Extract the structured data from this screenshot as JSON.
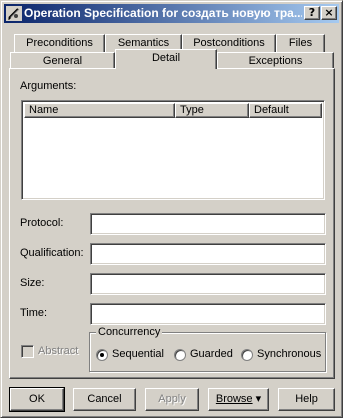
{
  "window": {
    "title": "Operation Specification for создать новую тра...",
    "help_glyph": "?",
    "close_glyph": "×",
    "icon": "pencil-icon"
  },
  "tabs": {
    "row1": [
      {
        "label": "Preconditions"
      },
      {
        "label": "Semantics"
      },
      {
        "label": "Postconditions"
      },
      {
        "label": "Files"
      }
    ],
    "row2": [
      {
        "label": "General"
      },
      {
        "label": "Detail"
      },
      {
        "label": "Exceptions"
      }
    ],
    "active": "Detail"
  },
  "detail": {
    "arguments_label": "Arguments:",
    "columns": [
      "Name",
      "Type",
      "Default"
    ],
    "rows": [],
    "protocol_label": "Protocol:",
    "protocol_value": "",
    "qualification_label": "Qualification:",
    "qualification_value": "",
    "size_label": "Size:",
    "size_value": "",
    "time_label": "Time:",
    "time_value": "",
    "abstract_label": "Abstract",
    "abstract_checked": false,
    "concurrency": {
      "title": "Concurrency",
      "options": [
        "Sequential",
        "Guarded",
        "Synchronous"
      ],
      "selected": "Sequential"
    }
  },
  "buttons": {
    "ok": "OK",
    "cancel": "Cancel",
    "apply": "Apply",
    "browse": "Browse",
    "browse_arrow": "▾",
    "help": "Help"
  },
  "colors": {
    "title_gradient_start": "#0a246a",
    "title_gradient_end": "#a6caf0",
    "face": "#d4d0c8"
  }
}
